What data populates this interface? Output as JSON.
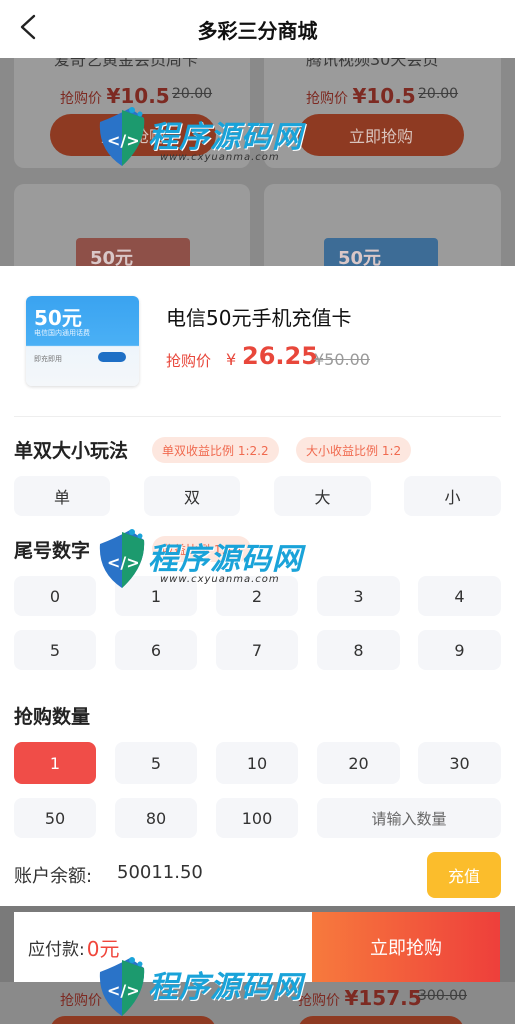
{
  "header": {
    "title": "多彩三分商城"
  },
  "background": {
    "cards": [
      {
        "name": "爱奇艺黄金会员周卡",
        "price_label": "抢购价",
        "price": "¥10.5",
        "original": "20.00",
        "button": "立即抢购"
      },
      {
        "name": "腾讯视频30天会员",
        "price_label": "抢购价",
        "price": "¥10.5",
        "original": "20.00",
        "button": "立即抢购"
      }
    ],
    "thumb_left": "50元",
    "thumb_right": "50元",
    "bottom_left_price_label": "抢购价",
    "bottom_left_price": "¥5",
    "bottom_right_price_label": "抢购价",
    "bottom_right_price": "¥157.5",
    "bottom_right_original": "300.00"
  },
  "product": {
    "image": {
      "amount": "50元",
      "subtitle": "电信国内通用话费",
      "bottom": "即充即用"
    },
    "name": "电信50元手机充值卡",
    "price_label": "抢购价",
    "price_yen": "¥",
    "price": "26.25",
    "original": "¥50.00"
  },
  "play": {
    "title": "单双大小玩法",
    "tags": [
      "单双收益比例 1:2.2",
      "大小收益比例 1:2"
    ],
    "options": [
      "单",
      "双",
      "大",
      "小"
    ]
  },
  "tail": {
    "title": "尾号数字",
    "tag": "收益比例 1:10",
    "digits": [
      "0",
      "1",
      "2",
      "3",
      "4",
      "5",
      "6",
      "7",
      "8",
      "9"
    ]
  },
  "quantity": {
    "title": "抢购数量",
    "options": [
      "1",
      "5",
      "10",
      "20",
      "30",
      "50",
      "80",
      "100"
    ],
    "selected": "1",
    "input_placeholder": "请输入数量"
  },
  "account": {
    "balance_label": "账户余额:",
    "balance": "50011.50",
    "recharge_button": "充值"
  },
  "pay": {
    "label": "应付款:",
    "value": "0元",
    "button": "立即抢购"
  },
  "watermark": {
    "brand": "程序源码网",
    "url": "www.cxyuanma.com"
  },
  "colors": {
    "accent": "#f04d48",
    "recharge": "#fbbd2c",
    "tag_bg": "#fde7df",
    "tag_text": "#f06a4f"
  }
}
